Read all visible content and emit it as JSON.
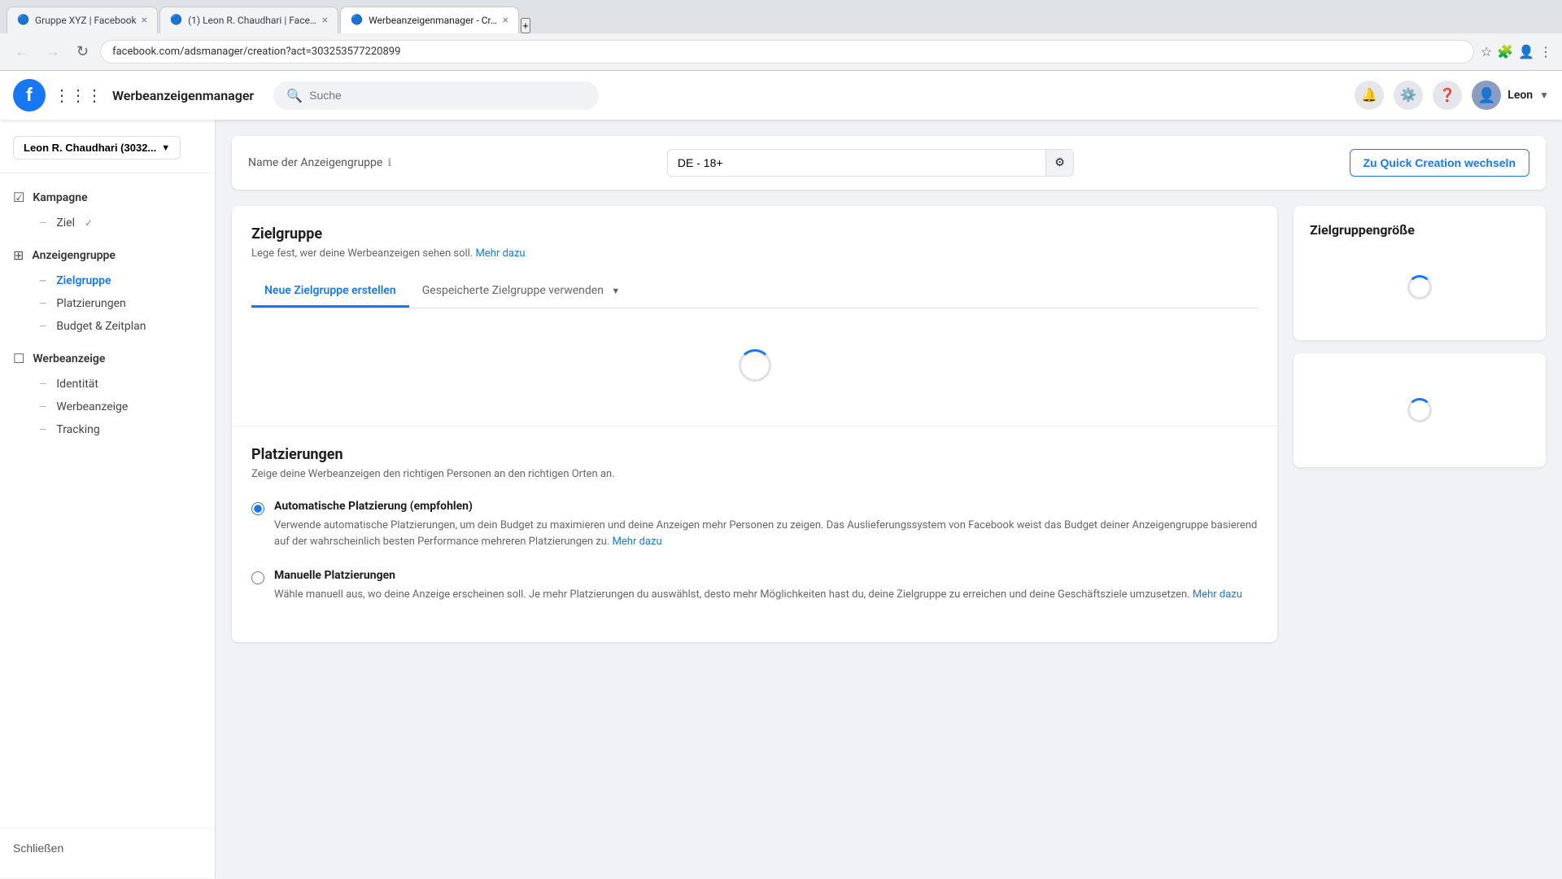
{
  "browser": {
    "tabs": [
      {
        "id": "tab1",
        "title": "Gruppe XYZ | Facebook",
        "favicon": "🔵",
        "active": false
      },
      {
        "id": "tab2",
        "title": "(1) Leon R. Chaudhari | Faceb...",
        "favicon": "🔵",
        "active": false
      },
      {
        "id": "tab3",
        "title": "Werbeanzeigenmanager - Cr...",
        "favicon": "🔵",
        "active": true
      }
    ],
    "address": "facebook.com/adsmanager/creation?act=303253577220899",
    "new_tab_label": "+"
  },
  "fb_bar": {
    "logo_char": "f",
    "app_title": "Werbeanzeigenmanager",
    "search_placeholder": "Suche",
    "user_name": "Leon",
    "icons": [
      "🔔",
      "⚙️",
      "❓"
    ]
  },
  "sidebar": {
    "account_label": "Leon R. Chaudhari (3032...",
    "sections": [
      {
        "id": "kampagne",
        "icon": "☑",
        "label": "Kampagne",
        "sub_items": [
          {
            "id": "ziel",
            "label": "Ziel",
            "has_check": true,
            "active": false
          }
        ]
      },
      {
        "id": "anzeigengruppe",
        "icon": "⊞",
        "label": "Anzeigengruppe",
        "sub_items": [
          {
            "id": "zielgruppe",
            "label": "Zielgruppe",
            "active": true
          },
          {
            "id": "platzierungen",
            "label": "Platzierungen",
            "active": false
          },
          {
            "id": "budget-zeitplan",
            "label": "Budget & Zeitplan",
            "active": false
          }
        ]
      },
      {
        "id": "werbeanzeige",
        "icon": "☐",
        "label": "Werbeanzeige",
        "sub_items": [
          {
            "id": "identitaet",
            "label": "Identität",
            "active": false
          },
          {
            "id": "werbeanzeige-sub",
            "label": "Werbeanzeige",
            "active": false
          },
          {
            "id": "tracking",
            "label": "Tracking",
            "active": false
          }
        ]
      }
    ],
    "close_label": "Schließen"
  },
  "main": {
    "ad_name_section": {
      "label": "Name der Anzeigengruppe",
      "info_icon": "ℹ",
      "value": "DE - 18+",
      "quick_create_btn": "Zu Quick Creation wechseln"
    },
    "zielgruppe": {
      "title": "Zielgruppe",
      "subtitle": "Lege fest, wer deine Werbeanzeigen sehen soll.",
      "mehr_dazu_link": "Mehr dazu",
      "tabs": [
        {
          "id": "neue",
          "label": "Neue Zielgruppe erstellen",
          "active": true
        },
        {
          "id": "gespeicherte",
          "label": "Gespeicherte Zielgruppe verwenden",
          "active": false
        }
      ]
    },
    "platzierungen": {
      "title": "Platzierungen",
      "subtitle": "Zeige deine Werbeanzeigen den richtigen Personen an den richtigen Orten an.",
      "options": [
        {
          "id": "automatisch",
          "label": "Automatische Platzierung (empfohlen)",
          "description": "Verwende automatische Platzierungen, um dein Budget zu maximieren und deine Anzeigen mehr Personen zu zeigen. Das Auslieferungssystem von Facebook weist das Budget deiner Anzeigengruppe basierend auf der wahrscheinlich besten Performance mehreren Platzierungen zu.",
          "mehr_dazu": "Mehr dazu",
          "checked": true
        },
        {
          "id": "manuell",
          "label": "Manuelle Platzierungen",
          "description": "Wähle manuell aus, wo deine Anzeige erscheinen soll. Je mehr Platzierungen du auswählst, desto mehr Möglichkeiten hast du, deine Zielgruppe zu erreichen und deine Geschäftsziele umzusetzen.",
          "mehr_dazu": "Mehr dazu",
          "checked": false
        }
      ]
    },
    "side_panel": {
      "title": "Zielgruppengröße"
    }
  }
}
